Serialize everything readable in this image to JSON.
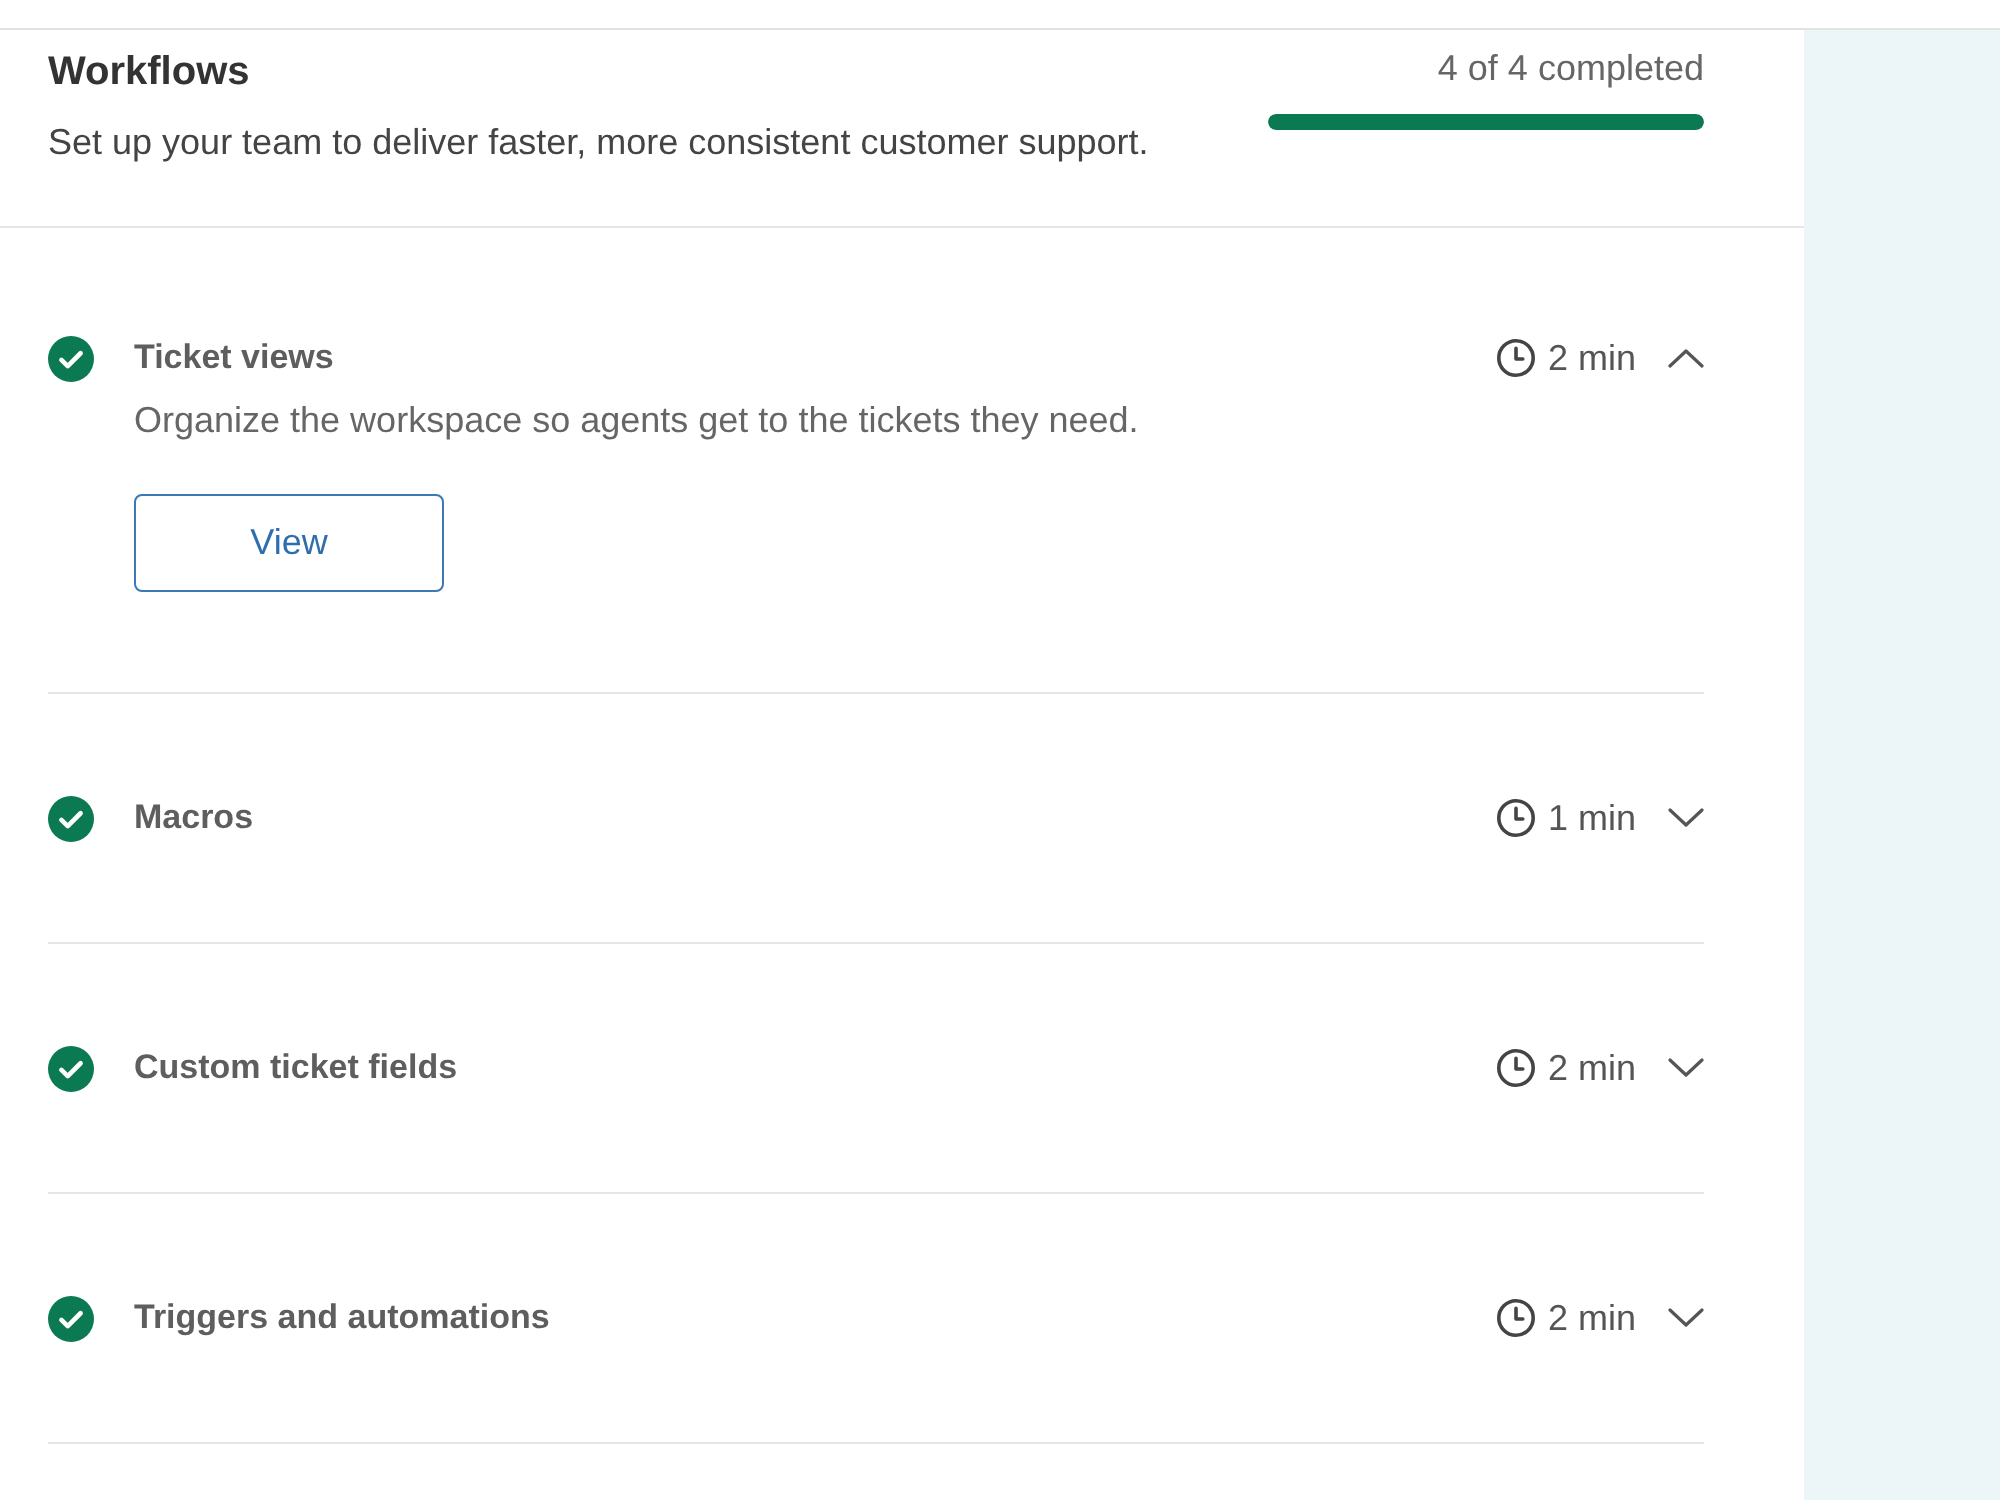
{
  "header": {
    "title": "Workflows",
    "subtitle": "Set up your team to deliver faster, more consistent customer support.",
    "progress": {
      "text": "4 of 4 completed",
      "level": 1
    }
  },
  "items": [
    {
      "title": "Ticket views",
      "completed": true,
      "duration": "2 min",
      "expanded": true,
      "description": "Organize the workspace so agents get to the tickets they need.",
      "button": "View"
    },
    {
      "title": "Macros",
      "completed": true,
      "duration": "1 min",
      "expanded": false
    },
    {
      "title": "Custom ticket fields",
      "completed": true,
      "duration": "2 min",
      "expanded": false
    },
    {
      "title": "Triggers and automations",
      "completed": true,
      "duration": "2 min",
      "expanded": false
    }
  ]
}
